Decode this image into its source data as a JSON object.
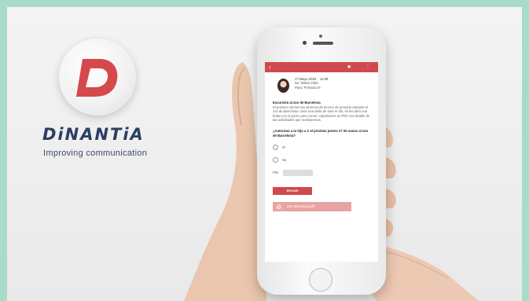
{
  "brand": {
    "name": "DiNANTiA",
    "tagline": "Improving communication",
    "logo_letter": "D",
    "colors": {
      "accent": "#cf4a4e",
      "navy": "#2d3e63"
    }
  },
  "app": {
    "back_icon": "chevron-left-icon",
    "star_icon": "star-icon",
    "menu_icon": "more-icon",
    "message": {
      "date": "17 Mayo 2016",
      "time": "11:09",
      "from": "De: Marta Vidal",
      "to": "Para: Primaria 5º",
      "title": "Excursión al zoo de Barcelona",
      "body": "El próximo viernes los alumnos de tercero de primaria visitarán el zoo de Barcelona. Será una visita de todo el día, se les dará una bolsa con el picnic para comer. Adjuntamos un PDF con detalle de las actividades que realizaremos.",
      "question": "¿Autorizas a tu hijo a ir el próximo jueves 27 de marzo al zoo de Barcelona?",
      "options": [
        "Sí",
        "No"
      ],
      "pin_label": "PIN",
      "send_label": "ENVIAR",
      "attachment_label": "Zoo Barcelona.pdf"
    }
  }
}
